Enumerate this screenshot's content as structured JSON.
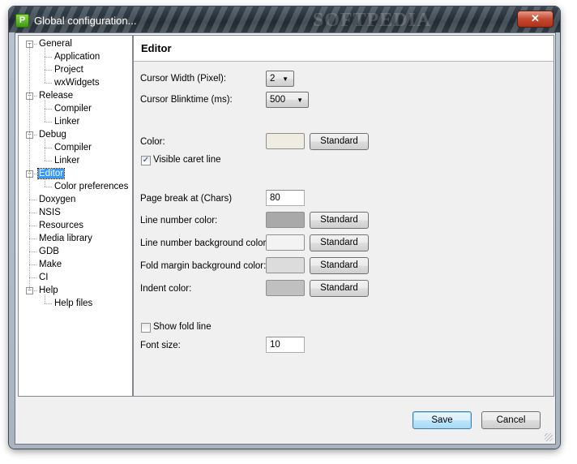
{
  "window": {
    "title": "Global configuration...",
    "app_icon_letter": "P",
    "close_glyph": "✕",
    "watermark": "SOFTPEDIA"
  },
  "tree": {
    "items": [
      {
        "label": "General",
        "level": 0,
        "expander": "−"
      },
      {
        "label": "Application",
        "level": 1
      },
      {
        "label": "Project",
        "level": 1
      },
      {
        "label": "wxWidgets",
        "level": 1
      },
      {
        "label": "Release",
        "level": 0,
        "expander": "−"
      },
      {
        "label": "Compiler",
        "level": 1
      },
      {
        "label": "Linker",
        "level": 1
      },
      {
        "label": "Debug",
        "level": 0,
        "expander": "−"
      },
      {
        "label": "Compiler",
        "level": 1
      },
      {
        "label": "Linker",
        "level": 1
      },
      {
        "label": "Editor",
        "level": 0,
        "expander": "−",
        "selected": true
      },
      {
        "label": "Color preferences",
        "level": 1
      },
      {
        "label": "Doxygen",
        "level": 0
      },
      {
        "label": "NSIS",
        "level": 0
      },
      {
        "label": "Resources",
        "level": 0
      },
      {
        "label": "Media library",
        "level": 0
      },
      {
        "label": "GDB",
        "level": 0
      },
      {
        "label": "Make",
        "level": 0
      },
      {
        "label": "CI",
        "level": 0
      },
      {
        "label": "Help",
        "level": 0,
        "expander": "−"
      },
      {
        "label": "Help files",
        "level": 1
      }
    ]
  },
  "panel": {
    "title": "Editor",
    "cursor_width": {
      "label": "Cursor Width (Pixel):",
      "value": "2"
    },
    "cursor_blinktime": {
      "label": "Cursor Blinktime (ms):",
      "value": "500"
    },
    "color": {
      "label": "Color:",
      "swatch": "#efede2",
      "button": "Standard"
    },
    "visible_caret_line": {
      "label": "Visible caret line",
      "checked": true
    },
    "page_break": {
      "label": "Page break at (Chars)",
      "value": "80"
    },
    "line_number_color": {
      "label": "Line number color:",
      "swatch": "#a9a9a9",
      "button": "Standard"
    },
    "line_number_bg_color": {
      "label": "Line number background color:",
      "swatch": "#f3f3f3",
      "button": "Standard"
    },
    "fold_margin_bg_color": {
      "label": "Fold margin background color:",
      "swatch": "#dcdcdc",
      "button": "Standard"
    },
    "indent_color": {
      "label": "Indent color:",
      "swatch": "#c0c0c0",
      "button": "Standard"
    },
    "show_fold_line": {
      "label": "Show fold line",
      "checked": false
    },
    "font_size": {
      "label": "Font size:",
      "value": "10"
    }
  },
  "footer": {
    "save": "Save",
    "cancel": "Cancel"
  }
}
